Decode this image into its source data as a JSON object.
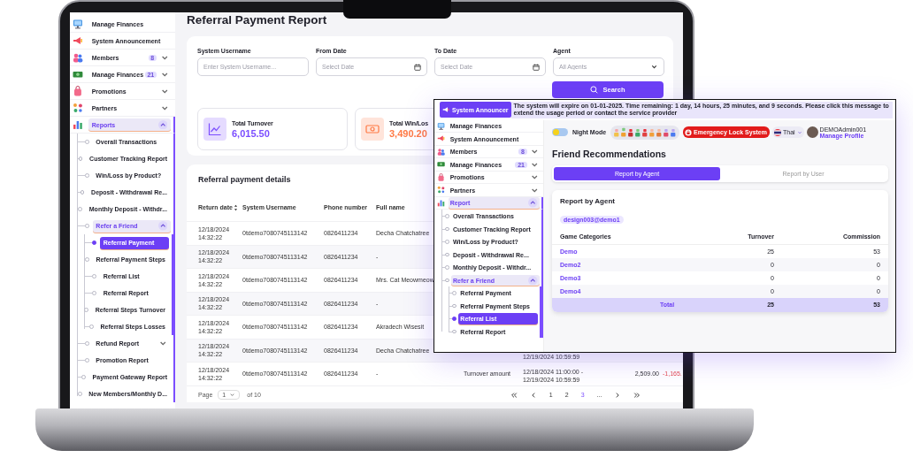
{
  "laptop": {
    "sidebar": {
      "items": [
        {
          "label": "Manage Finances",
          "selected": false
        },
        {
          "label": "System Announcement",
          "selected": false
        },
        {
          "label": "Members",
          "badge": "8",
          "expanded": false,
          "selected": false
        },
        {
          "label": "Manage Finances",
          "badge": "21",
          "expanded": false,
          "selected": false
        },
        {
          "label": "Promotions",
          "expanded": false,
          "selected": false
        },
        {
          "label": "Partners",
          "expanded": false,
          "selected": false
        },
        {
          "label": "Reports",
          "expanded": true,
          "selected": false,
          "children": [
            {
              "label": "Overall Transactions",
              "selected": false
            },
            {
              "label": "Customer Tracking Report",
              "selected": false
            },
            {
              "label": "Win/Loss by Product?",
              "selected": false
            },
            {
              "label": "Deposit - Withdrawal Re...",
              "selected": false
            },
            {
              "label": "Monthly Deposit - Withdr...",
              "selected": false
            },
            {
              "label": "Refer a Friend",
              "expanded": true,
              "selected": false,
              "children": [
                {
                  "label": "Referral Payment",
                  "selected": true
                },
                {
                  "label": "Referral Payment Steps",
                  "selected": false
                },
                {
                  "label": "Referral List",
                  "selected": false
                },
                {
                  "label": "Referral Report",
                  "selected": false
                },
                {
                  "label": "Referral Steps Turnover",
                  "selected": false
                },
                {
                  "label": "Referral Steps Losses",
                  "selected": false
                }
              ]
            },
            {
              "label": "Refund Report",
              "expanded": false,
              "selected": false
            },
            {
              "label": "Promotion Report",
              "selected": false
            },
            {
              "label": "Payment Gateway Report",
              "selected": false
            },
            {
              "label": "New Members/Monthly D...",
              "selected": false
            }
          ]
        }
      ]
    },
    "page": {
      "title": "Referral Payment Report",
      "filters": [
        {
          "kind": "text",
          "label": "System Username",
          "placeholder": "Enter System Username..."
        },
        {
          "kind": "date",
          "label": "From Date",
          "placeholder": "Select Date"
        },
        {
          "kind": "date",
          "label": "To Date",
          "placeholder": "Select Date"
        },
        {
          "kind": "select",
          "label": "Agent",
          "placeholder": "All Agents"
        }
      ],
      "search_button": "Search",
      "stats": [
        {
          "label": "Total Turnover",
          "value": "6,015.50",
          "color": "#7b4dff"
        },
        {
          "label": "Total Win/Los",
          "value": "3,490.20",
          "color": "#ff7a45"
        }
      ],
      "table": {
        "title": "Referral payment details",
        "columns": [
          {
            "label": "Return date",
            "sortable": true
          },
          {
            "label": "System Username",
            "sortable": false
          },
          {
            "label": "Phone number",
            "sortable": false
          },
          {
            "label": "Full name",
            "sortable": false
          }
        ],
        "rows": [
          {
            "return_date": "12/18/2024 14:32:22",
            "system_username": "0tdemo7080745113142",
            "phone_number": "0826411234",
            "full_name": "Decha Chatchatree"
          },
          {
            "return_date": "12/18/2024 14:32:22",
            "system_username": "0tdemo7080745113142",
            "phone_number": "0826411234",
            "full_name": "-"
          },
          {
            "return_date": "12/18/2024 14:32:22",
            "system_username": "0tdemo7080745113142",
            "phone_number": "0826411234",
            "full_name": "Mrs. Cat Meowmeow"
          },
          {
            "return_date": "12/18/2024 14:32:22",
            "system_username": "0tdemo7080745113142",
            "phone_number": "0826411234",
            "full_name": "-"
          },
          {
            "return_date": "12/18/2024 14:32:22",
            "system_username": "0tdemo7080745113142",
            "phone_number": "0826411234",
            "full_name": "Akradech Wisesit"
          },
          {
            "return_date": "12/18/2024 14:32:22",
            "system_username": "0tdemo7080745113142",
            "phone_number": "0826411234",
            "full_name": "Decha Chatchatree",
            "column_6": "12/19/2024 10:59:59"
          },
          {
            "return_date": "12/18/2024 14:32:22",
            "system_username": "0tdemo7080745113142",
            "phone_number": "0826411234",
            "full_name": "-",
            "column_5": "Turnover amount",
            "column_6": "12/18/2024 11:00:00 - 12/19/2024 10:59:59",
            "column_7": "2,509.00",
            "column_8": "-1,165."
          }
        ],
        "pagination": {
          "page_label": "Page",
          "page": "1",
          "of_label": "of 10",
          "pages": [
            {
              "label": "1",
              "selected": false
            },
            {
              "label": "2",
              "selected": false
            },
            {
              "label": "3",
              "selected": true
            },
            {
              "label": "...",
              "selected": false
            }
          ]
        }
      }
    }
  },
  "overlay": {
    "announcement": {
      "button": "System Announcer",
      "message": "The system will expire on 01-01-2025. Time remaining: 1 day, 14 hours, 25 minutes, and 9 seconds. Please click this message to extend the usage period or contact the service provider"
    },
    "header": {
      "night_mode": {
        "label": "Night Mode",
        "on": false
      },
      "emergency_button": "Emergency Lock System",
      "language": "Thai",
      "user": {
        "name": "DEMOAdmin001",
        "link": "Manage Profile"
      }
    },
    "sidebar": {
      "items": [
        {
          "label": "Manage Finances",
          "selected": false
        },
        {
          "label": "System Announcement",
          "selected": false
        },
        {
          "label": "Members",
          "badge": "8",
          "expanded": false,
          "selected": false
        },
        {
          "label": "Manage Finances",
          "badge": "21",
          "expanded": false,
          "selected": false
        },
        {
          "label": "Promotions",
          "expanded": false,
          "selected": false
        },
        {
          "label": "Partners",
          "expanded": false,
          "selected": false
        },
        {
          "label": "Report",
          "expanded": true,
          "selected": false,
          "children": [
            {
              "label": "Overall Transactions",
              "selected": false
            },
            {
              "label": "Customer Tracking Report",
              "selected": false
            },
            {
              "label": "Win/Loss by Product?",
              "selected": false
            },
            {
              "label": "Deposit - Withdrawal Re...",
              "selected": false
            },
            {
              "label": "Monthly Deposit - Withdr...",
              "selected": false
            },
            {
              "label": "Refer a Friend",
              "expanded": true,
              "selected": false,
              "children": [
                {
                  "label": "Referral Payment",
                  "selected": false
                },
                {
                  "label": "Referral Payment Steps",
                  "selected": false
                },
                {
                  "label": "Referral List",
                  "selected": true
                },
                {
                  "label": "Referral Report",
                  "selected": false
                }
              ]
            }
          ]
        }
      ]
    },
    "title": "Friend Recommendations",
    "tabs": [
      {
        "label": "Report by Agent",
        "selected": true
      },
      {
        "label": "Report by User",
        "selected": false
      }
    ],
    "report": {
      "title": "Report by Agent",
      "chip": "design003@demo1",
      "columns": [
        "Game Categories",
        "Turnover",
        "Commission"
      ],
      "rows": [
        [
          "Demo",
          "25",
          "53"
        ],
        [
          "Demo2",
          "0",
          "0"
        ],
        [
          "Demo3",
          "0",
          "0"
        ],
        [
          "Demo4",
          "0",
          "0"
        ]
      ],
      "total": [
        "Total",
        "25",
        "53"
      ]
    }
  }
}
